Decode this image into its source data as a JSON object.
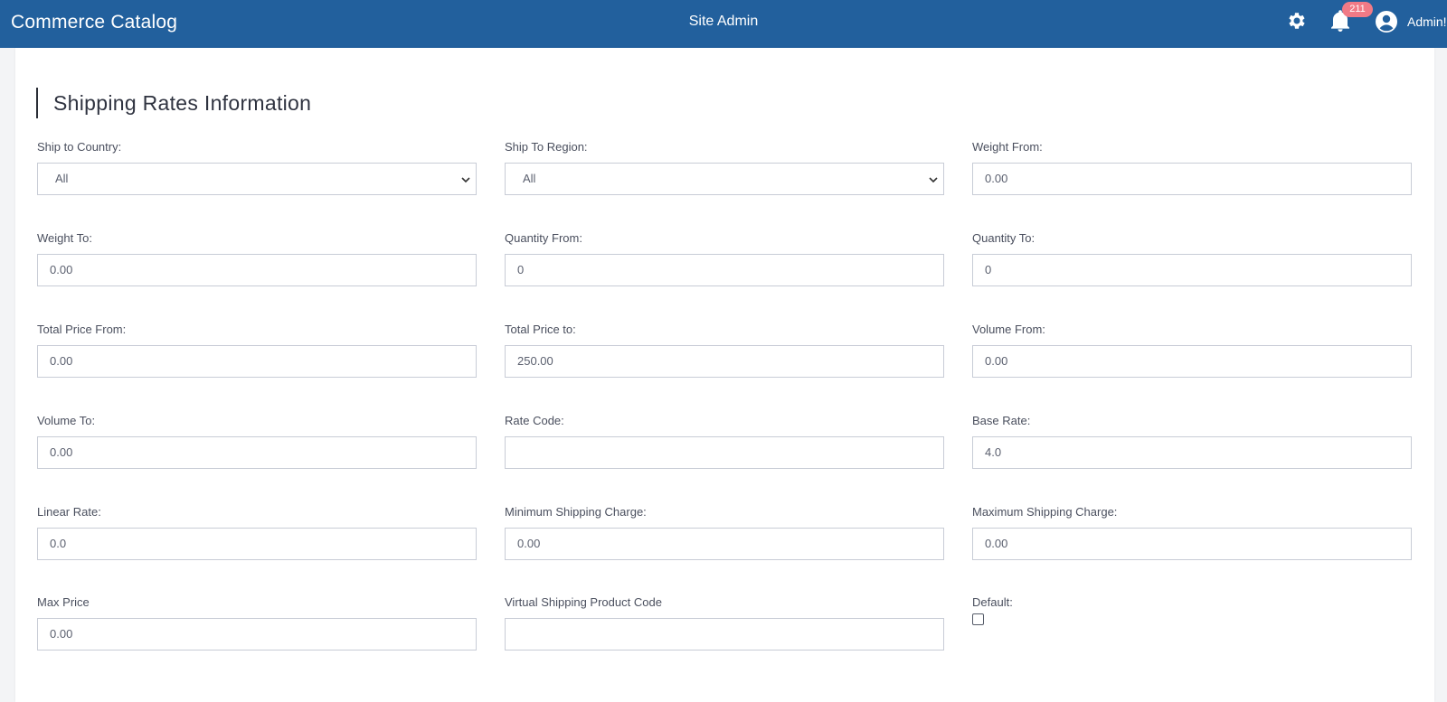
{
  "header": {
    "brand": "Commerce Catalog",
    "center_title": "Site Admin",
    "notification_count": "211",
    "user_label": "Admin!",
    "icons": {
      "settings": "gear-icon",
      "notifications": "bell-icon",
      "user": "user-circle-icon",
      "caret": "chevron-down-icon"
    },
    "colors": {
      "bar": "#22609d",
      "badge": "#f07a86"
    }
  },
  "form": {
    "title": "Shipping Rates Information",
    "ship_to_country": {
      "label": "Ship to Country:",
      "value": "All"
    },
    "ship_to_region": {
      "label": "Ship To Region:",
      "value": "All"
    },
    "weight_from": {
      "label": "Weight From:",
      "value": "0.00"
    },
    "weight_to": {
      "label": "Weight To:",
      "value": "0.00"
    },
    "quantity_from": {
      "label": "Quantity From:",
      "value": "0"
    },
    "quantity_to": {
      "label": "Quantity To:",
      "value": "0"
    },
    "total_price_from": {
      "label": "Total Price From:",
      "value": "0.00"
    },
    "total_price_to": {
      "label": "Total Price to:",
      "value": "250.00"
    },
    "volume_from": {
      "label": "Volume From:",
      "value": "0.00"
    },
    "volume_to": {
      "label": "Volume To:",
      "value": "0.00"
    },
    "rate_code": {
      "label": "Rate Code:",
      "value": ""
    },
    "base_rate": {
      "label": "Base Rate:",
      "value": "4.0"
    },
    "linear_rate": {
      "label": "Linear Rate:",
      "value": "0.0"
    },
    "min_shipping_charge": {
      "label": "Minimum Shipping Charge:",
      "value": "0.00"
    },
    "max_shipping_charge": {
      "label": "Maximum Shipping Charge:",
      "value": "0.00"
    },
    "max_price": {
      "label": "Max Price",
      "value": "0.00"
    },
    "virtual_shipping_product_code": {
      "label": "Virtual Shipping Product Code",
      "value": ""
    },
    "default": {
      "label": "Default:",
      "checked": false
    }
  }
}
